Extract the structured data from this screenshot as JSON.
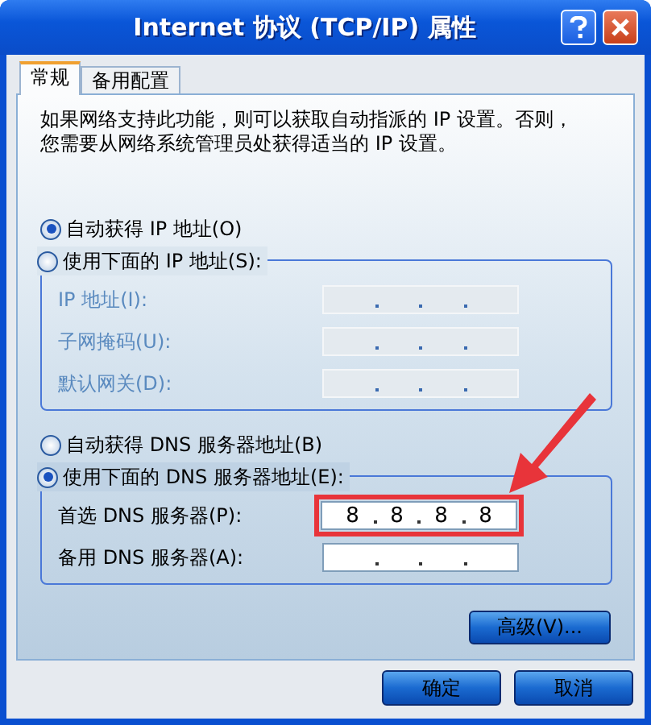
{
  "window": {
    "title": "Internet 协议 (TCP/IP) 属性"
  },
  "tabs": [
    {
      "label": "常规",
      "selected": true
    },
    {
      "label": "备用配置",
      "selected": false
    }
  ],
  "description": "如果网络支持此功能，则可以获取自动指派的 IP 设置。否则，您需要从网络系统管理员处获得适当的 IP 设置。",
  "ip_section": {
    "auto_option": {
      "label": "自动获得 IP 地址(O)",
      "selected": true
    },
    "manual_option": {
      "label": "使用下面的 IP 地址(S):",
      "selected": false
    },
    "fields": [
      {
        "label": "IP 地址(I):",
        "disabled": true
      },
      {
        "label": "子网掩码(U):",
        "disabled": true
      },
      {
        "label": "默认网关(D):",
        "disabled": true
      }
    ]
  },
  "dns_section": {
    "auto_option": {
      "label": "自动获得 DNS 服务器地址(B)",
      "selected": false
    },
    "manual_option": {
      "label": "使用下面的 DNS 服务器地址(E):",
      "selected": true
    },
    "fields": [
      {
        "label": "首选 DNS 服务器(P):",
        "disabled": false,
        "octets": [
          "8",
          "8",
          "8",
          "8"
        ],
        "highlighted": true
      },
      {
        "label": "备用 DNS 服务器(A):",
        "disabled": false,
        "highlighted": false
      }
    ]
  },
  "advanced_button": "高级(V)...",
  "buttons": [
    "确定",
    "取消"
  ]
}
